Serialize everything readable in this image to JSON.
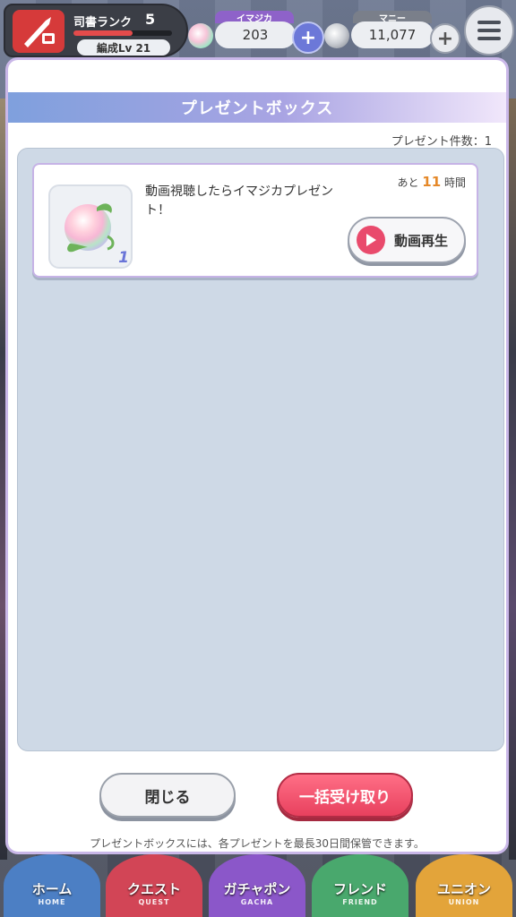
{
  "header": {
    "rank_label": "司書ランク",
    "rank_value": "5",
    "rank_progress": 0.6,
    "formation_level": "編成Lv 21",
    "imajika": {
      "label": "イマジカ",
      "value": "203",
      "label_color": "#8e62c9"
    },
    "money": {
      "label": "マニー",
      "value": "11,077",
      "label_color": "#7a7f8a"
    },
    "menu_icon": "hamburger-icon"
  },
  "dialog": {
    "title": "プレゼントボックス",
    "count_text": "プレゼント件数：1",
    "items": [
      {
        "description": "動画視聴したらイマジカプレゼント！",
        "quantity": "1",
        "remaining_prefix": "あと",
        "remaining_value": "11",
        "remaining_suffix": "時間",
        "action_label": "動画再生",
        "icon": "imajika-orb-icon"
      }
    ],
    "close_label": "閉じる",
    "receive_all_label": "一括受け取り",
    "footer_note": "プレゼントボックスには、各プレゼントを最長30日間保管できます。"
  },
  "nav": [
    {
      "label": "ホーム",
      "sub": "HOME",
      "color": "#4c7fc4"
    },
    {
      "label": "クエスト",
      "sub": "QUEST",
      "color": "#d24556"
    },
    {
      "label": "ガチャポン",
      "sub": "GACHA",
      "color": "#8b57c9"
    },
    {
      "label": "フレンド",
      "sub": "FRIEND",
      "color": "#49a86d"
    },
    {
      "label": "ユニオン",
      "sub": "UNION",
      "color": "#e3a43a"
    }
  ]
}
